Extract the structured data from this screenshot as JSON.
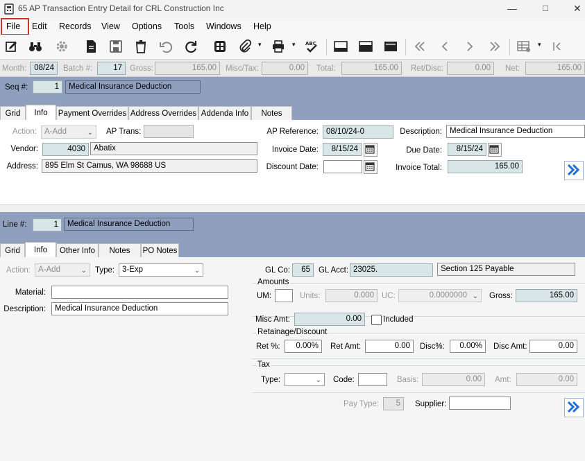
{
  "window": {
    "title": "65 AP Transaction Entry Detail for CRL Construction Inc",
    "controls": [
      "minimize-icon",
      "maximize-icon",
      "close-icon"
    ]
  },
  "menu": [
    "File",
    "Edit",
    "Records",
    "View",
    "Options",
    "Tools",
    "Windows",
    "Help"
  ],
  "toolbar_icons": [
    "edit-icon",
    "binoculars-icon",
    "gear-icon",
    "document-icon",
    "save-icon",
    "trash-icon",
    "undo-icon",
    "refresh-icon",
    "calculator-icon",
    "attach-icon",
    "print-icon",
    "spellcheck-icon",
    "layout-bottom-icon",
    "layout-middle-icon",
    "layout-top-icon",
    "first-icon",
    "prev-icon",
    "next-icon",
    "last-icon",
    "grid-icon",
    "collapse-icon"
  ],
  "header": {
    "month_label": "Month:",
    "month": "08/24",
    "batch_label": "Batch #:",
    "batch": "17",
    "gross_label": "Gross:",
    "gross": "165.00",
    "misc_label": "Misc/Tax:",
    "misc": "0.00",
    "total_label": "Total:",
    "total": "165.00",
    "retdisc_label": "Ret/Disc:",
    "retdisc": "0.00",
    "net_label": "Net:",
    "net": "165.00"
  },
  "seq": {
    "label": "Seq #:",
    "value": "1",
    "desc": "Medical Insurance Deduction"
  },
  "tabs1": [
    "Grid",
    "Info",
    "Payment Overrides",
    "Address Overrides",
    "Addenda Info",
    "Notes"
  ],
  "info1": {
    "action_label": "Action:",
    "action": "A-Add",
    "aptrans_label": "AP Trans:",
    "aptrans": "",
    "vendor_label": "Vendor:",
    "vendor": "4030",
    "vendor_name": "Abatix",
    "address_label": "Address:",
    "address": "895 Elm St  Camus,  WA  98688  US",
    "apref_label": "AP Reference:",
    "apref": "08/10/24-0",
    "invdate_label": "Invoice Date:",
    "invdate": "8/15/24",
    "discdate_label": "Discount Date:",
    "discdate": "",
    "descr_label": "Description:",
    "descr": "Medical Insurance Deduction",
    "duedate_label": "Due Date:",
    "duedate": "8/15/24",
    "invtotal_label": "Invoice Total:",
    "invtotal": "165.00"
  },
  "line": {
    "label": "Line #:",
    "value": "1",
    "desc": "Medical Insurance Deduction"
  },
  "tabs2": [
    "Grid",
    "Info",
    "Other Info",
    "Notes",
    "PO Notes"
  ],
  "info2": {
    "action_label": "Action:",
    "action": "A-Add",
    "type_label": "Type:",
    "type": "3-Exp",
    "material_label": "Material:",
    "material": "",
    "descr_label": "Description:",
    "descr": "Medical Insurance Deduction",
    "glco_label": "GL Co:",
    "glco": "65",
    "glacct_label": "GL Acct:",
    "glacct": "23025.",
    "glacct_desc": "Section 125 Payable",
    "amounts_label": "Amounts",
    "um_label": "UM:",
    "um": "",
    "units_label": "Units:",
    "units": "0.000",
    "uc_label": "UC:",
    "uc": "0.0000000",
    "gross_label": "Gross:",
    "gross": "165.00",
    "miscamt_label": "Misc Amt:",
    "miscamt": "0.00",
    "included_label": "Included",
    "retdisc_label": "Retainage/Discount",
    "retpct_label": "Ret %:",
    "retpct": "0.00%",
    "retamt_label": "Ret Amt:",
    "retamt": "0.00",
    "discpct_label": "Disc%:",
    "discpct": "0.00%",
    "discamt_label": "Disc Amt:",
    "discamt": "0.00",
    "tax_label": "Tax",
    "taxtype_label": "Type:",
    "taxtype": "",
    "code_label": "Code:",
    "code": "",
    "basis_label": "Basis:",
    "basis": "0.00",
    "amt_label": "Amt:",
    "amt": "0.00",
    "paytype_label": "Pay Type:",
    "paytype": "5",
    "supplier_label": "Supplier:",
    "supplier": ""
  },
  "colors": {
    "band": "#8fa0bf",
    "readonly": "#d8e6e8",
    "highlight": "#d0312d",
    "accent": "#1f6fd1"
  }
}
